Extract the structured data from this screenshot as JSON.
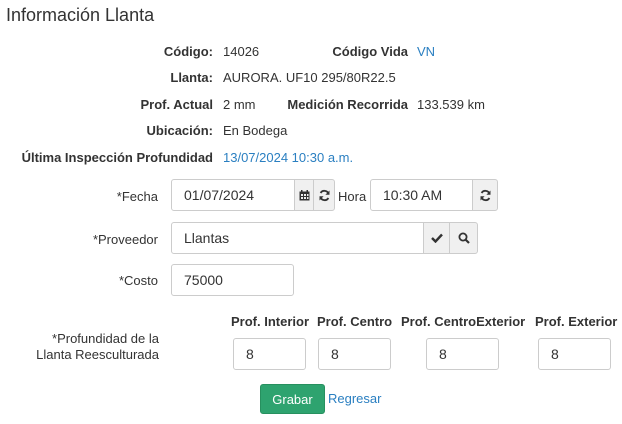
{
  "title": "Información Llanta",
  "info": {
    "codigo_label": "Código:",
    "codigo_value": "14026",
    "codigo_vida_label": "Código Vida",
    "codigo_vida_value": "VN",
    "llanta_label": "Llanta:",
    "llanta_value": "AURORA. UF10 295/80R22.5",
    "prof_actual_label": "Prof. Actual",
    "prof_actual_value": "2 mm",
    "medicion_label": "Medición Recorrida",
    "medicion_value": "133.539 km",
    "ubicacion_label": "Ubicación:",
    "ubicacion_value": "En Bodega",
    "ultima_label": "Última Inspección Profundidad",
    "ultima_value": "13/07/2024 10:30 a.m."
  },
  "form": {
    "fecha_label": "*Fecha",
    "fecha_value": "01/07/2024",
    "hora_label": "Hora",
    "hora_value": "10:30 AM",
    "proveedor_label": "*Proveedor",
    "proveedor_value": "Llantas",
    "costo_label": "*Costo",
    "costo_value": "75000",
    "profundidad_label_line1": "*Profundidad de la",
    "profundidad_label_line2": "Llanta Reesculturada",
    "columns": [
      "Prof. Interior",
      "Prof. Centro",
      "Prof. CentroExterior",
      "Prof. Exterior"
    ],
    "depth_values": [
      "8",
      "8",
      "8",
      "8"
    ]
  },
  "actions": {
    "save_label": "Grabar",
    "back_label": "Regresar"
  },
  "icons": {
    "calendar": "calendar-icon",
    "refresh": "refresh-icon",
    "check": "check-icon",
    "search": "search-icon"
  },
  "colors": {
    "link": "#2a7fc1",
    "primary_button": "#2ea36f"
  }
}
